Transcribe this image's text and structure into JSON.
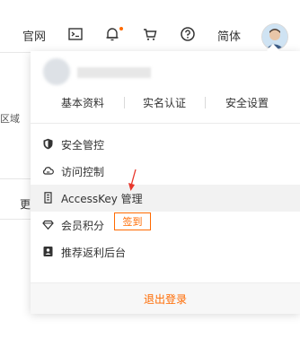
{
  "header": {
    "nav_official": "官网",
    "nav_simplified": "简体"
  },
  "background": {
    "region_label": "区域",
    "more_label": "更"
  },
  "dropdown": {
    "links": [
      "基本资料",
      "实名认证",
      "安全设置"
    ],
    "menu": [
      {
        "label": "安全管控",
        "icon": "shield-icon"
      },
      {
        "label": "访问控制",
        "icon": "cloud-icon"
      },
      {
        "label": "AccessKey 管理",
        "icon": "key-icon"
      },
      {
        "label": "会员积分",
        "icon": "diamond-icon",
        "action": "签到"
      },
      {
        "label": "推荐返利后台",
        "icon": "referral-icon"
      }
    ],
    "logout": "退出登录"
  },
  "colors": {
    "accent": "#ff6a00",
    "annotation_arrow": "#e8362b"
  }
}
